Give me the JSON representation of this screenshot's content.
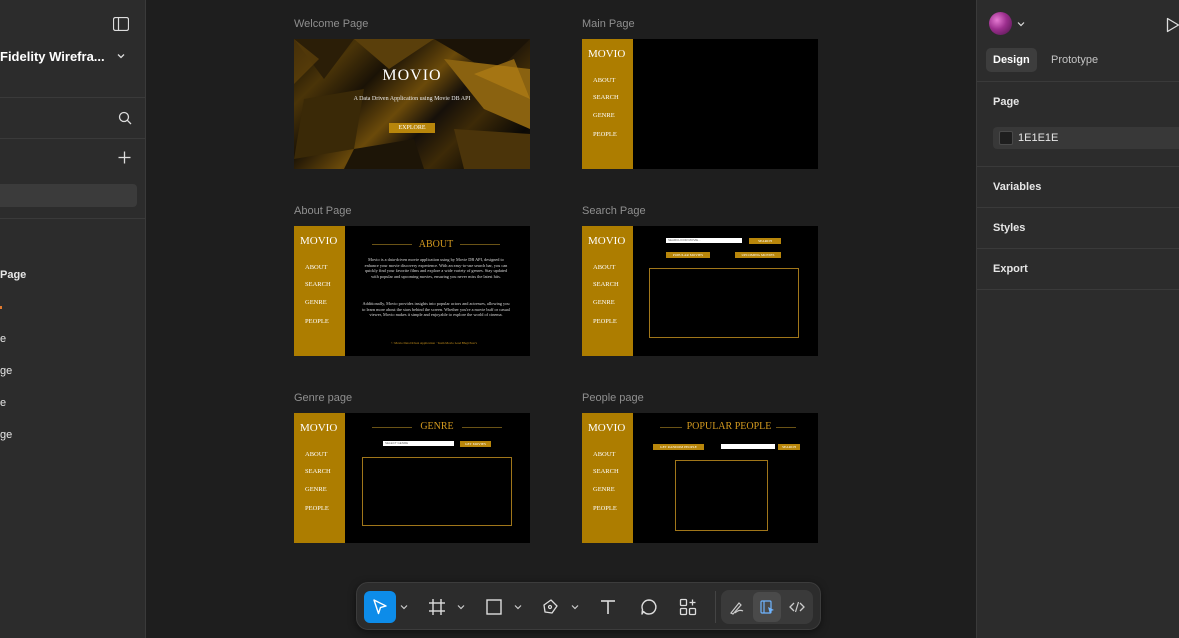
{
  "left_panel": {
    "file_title": "Fidelity Wirefra...",
    "layers": [
      "Page",
      "e",
      "ge",
      "e",
      "ge"
    ]
  },
  "canvas": {
    "frames": {
      "welcome": {
        "label": "Welcome Page",
        "title": "MOVIO",
        "subtitle": "A Data Driven Application  using Movie DB API",
        "button": "EXPLORE"
      },
      "main": {
        "label": "Main Page"
      },
      "about": {
        "label": "About Page",
        "heading": "ABOUT",
        "para1": "Movio is a data-driven movie application using by Movie DB API, designed to enhance your movie discovery experience. With an easy-to-use search bar, you can quickly find your favorite films and explore a wide variety of genres. Stay updated with popular and upcoming movies, ensuring you never miss the latest hits.",
        "para2": "Additionally, Movio provides insights into popular actors and actresses, allowing you to learn more about the stars behind the screen. Whether you're a movie buff or casual viewer, Movio makes it simple and enjoyable to explore the world of cinema.",
        "footer": "© Movio Data Driven Application · Team Movio Lead Bhaji Pear's"
      },
      "search": {
        "label": "Search Page",
        "input_placeholder": "SEARCH FOR MOVIE...",
        "search_button": "SEARCH",
        "popular_button": "POPULAR MOVIES",
        "upcoming_button": "UPCOMING MOVIES"
      },
      "genre": {
        "label": "Genre page",
        "heading": "GENRE",
        "select_placeholder": "SELECT GENRE",
        "get_button": "GET MOVIES"
      },
      "people": {
        "label": "People page",
        "heading": "POPULAR PEOPLE",
        "random_button": "GET RANDOM PEOPLE",
        "search_button": "SEARCH"
      }
    },
    "sidebar": {
      "logo": "MOVIO",
      "items": [
        "ABOUT",
        "SEARCH",
        "GENRE",
        "PEOPLE"
      ]
    }
  },
  "right_panel": {
    "tabs": [
      "Design",
      "Prototype"
    ],
    "page_heading": "Page",
    "page_color": "1E1E1E",
    "sections": [
      "Variables",
      "Styles",
      "Export"
    ]
  },
  "toolbar": {
    "tools": [
      "move-tool",
      "frame-tool",
      "shape-tool",
      "pen-tool",
      "text-tool",
      "comment-tool",
      "actions-tool"
    ],
    "modes": [
      "draw-mode",
      "design-mode",
      "dev-mode"
    ]
  },
  "colors": {
    "canvas_bg": "#1e1e1e",
    "panel_bg": "#2c2c2c",
    "accent": "#0d8ce9",
    "movio_gold": "#ad7d00",
    "movio_heading": "#d49a1f"
  }
}
